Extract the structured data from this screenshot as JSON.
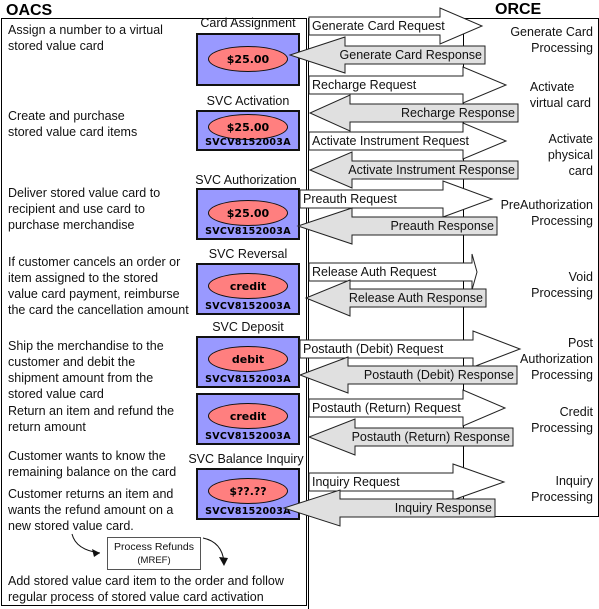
{
  "headers": {
    "left": "OACS",
    "right": "ORCE"
  },
  "steps": [
    {
      "description": [
        "Assign a number to a virtual",
        "stored value card"
      ],
      "card_title": "Card Assignment",
      "card_value": "$25.00",
      "card_id": "",
      "request": "Generate Card Request",
      "response": "Generate Card Response",
      "processing": [
        "Generate Card",
        "Processing"
      ]
    },
    {
      "description": [
        "Create and purchase",
        "stored value card items"
      ],
      "card_title": "SVC Activation",
      "card_value": "$25.00",
      "card_id": "SVCV8152003A",
      "request": "Recharge Request",
      "response": "Recharge Response",
      "processing": [
        "Activate",
        "virtual card"
      ]
    },
    {
      "description": [],
      "card_title": "",
      "card_value": "",
      "card_id": "",
      "request": "Activate Instrument Request",
      "response": "Activate Instrument Response",
      "processing": [
        "Activate",
        "physical",
        "card"
      ]
    },
    {
      "description": [
        "Deliver stored value card to",
        "recipient and use card to",
        "purchase merchandise"
      ],
      "card_title": "SVC Authorization",
      "card_value": "$25.00",
      "card_id": "SVCV8152003A",
      "request": "Preauth Request",
      "response": "Preauth Response",
      "processing": [
        "PreAuthorization",
        "Processing"
      ]
    },
    {
      "description": [
        "If customer cancels an order or",
        "item assigned to the stored",
        "value card payment, reimburse",
        "the card the cancellation amount"
      ],
      "card_title": "SVC Reversal",
      "card_value": "credit",
      "card_id": "SVCV8152003A",
      "request": "Release Auth Request",
      "response": "Release Auth Response",
      "processing": [
        "Void",
        "Processing"
      ]
    },
    {
      "description": [
        "Ship the merchandise to the",
        "customer and debit the",
        "shipment amount from the",
        "stored value card"
      ],
      "card_title": "SVC Deposit",
      "card_value": "debit",
      "card_id": "SVCV8152003A",
      "request": "Postauth (Debit) Request",
      "response": "Postauth (Debit) Response",
      "processing": [
        "Post",
        "Authorization",
        "Processing"
      ]
    },
    {
      "description": [
        "Return an item and refund the",
        "return amount"
      ],
      "card_title": "",
      "card_value": "credit",
      "card_id": "SVCV8152003A",
      "request": "Postauth (Return) Request",
      "response": "Postauth (Return) Response",
      "processing": [
        "Credit",
        "Processing"
      ]
    },
    {
      "description": [
        "Customer wants to know the",
        "remaining balance on the card"
      ],
      "card_title": "SVC Balance Inquiry",
      "card_value": "$??.??",
      "card_id": "SVCV8152003A",
      "request": "Inquiry Request",
      "response": "Inquiry Response",
      "processing": [
        "Inquiry",
        "Processing"
      ]
    }
  ],
  "refund_flow": {
    "intro": [
      "Customer returns an item and",
      "wants the refund amount on a",
      "new stored value card."
    ],
    "box_title": "Process Refunds",
    "box_code": "(MREF)",
    "outro": [
      "Add stored value card item to the order and follow",
      "regular process of stored value card activation"
    ]
  },
  "colors": {
    "card_fill": "#9999ff",
    "oval_fill": "#ff7f7f",
    "response_fill": "#e0e0e0",
    "request_fill": "#ffffff"
  }
}
